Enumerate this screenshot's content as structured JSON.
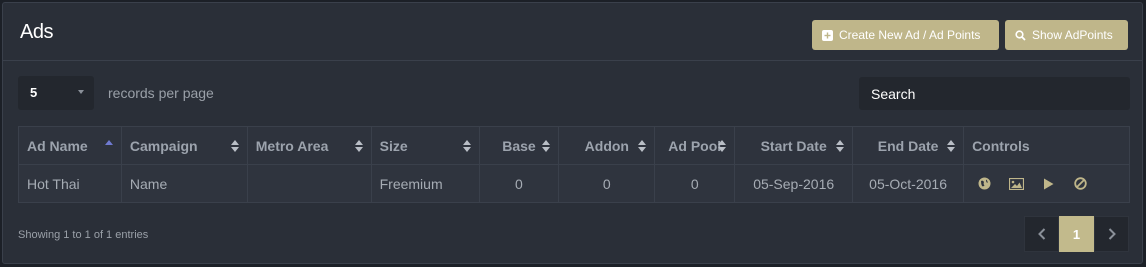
{
  "header": {
    "title": "Ads",
    "create_label": "Create New Ad / Ad Points",
    "show_label": "Show AdPoints"
  },
  "controls_bar": {
    "length_value": "5",
    "length_label": "records per page",
    "search_placeholder": "Search"
  },
  "table": {
    "columns": [
      "Ad Name",
      "Campaign",
      "Metro Area",
      "Size",
      "Base",
      "Addon",
      "Ad Pool",
      "Start Date",
      "End Date",
      "Controls"
    ],
    "rows": [
      {
        "ad_name": "Hot Thai",
        "campaign": "Name",
        "metro_area": "",
        "size": "Freemium",
        "base": "0",
        "addon": "0",
        "ad_pool": "0",
        "start_date": "05-Sep-2016",
        "end_date": "05-Oct-2016",
        "controls": [
          "globe-icon",
          "image-icon",
          "play-icon",
          "ban-icon"
        ]
      }
    ]
  },
  "footer": {
    "info": "Showing 1 to 1 of 1 entries",
    "current_page": "1"
  },
  "colors": {
    "accent": "#bfb68a",
    "panel": "#2a2f38",
    "field": "#23272e"
  }
}
